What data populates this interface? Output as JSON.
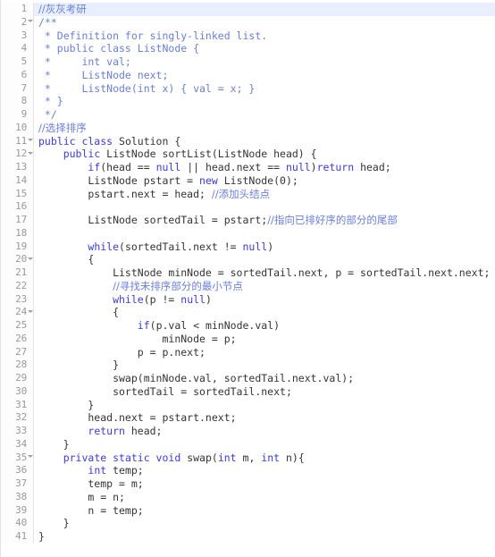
{
  "editor": {
    "language": "java",
    "current_line": 1,
    "total_lines": 41,
    "colors": {
      "background": "#ffffff",
      "gutter_background": "#fdfdfd",
      "gutter_text": "#999999",
      "separator": "#e3e3e3",
      "current_line_highlight": "#e8f0fe",
      "keyword": "#3b3bd6",
      "comment": "#6a7fd4",
      "identifier": "#333333"
    },
    "fold_lines": [
      2,
      11,
      12,
      20,
      24,
      35
    ],
    "lines": [
      {
        "n": "1",
        "tokens": [
          {
            "t": "//灰灰考研",
            "c": "cmt",
            "cjk": true
          }
        ]
      },
      {
        "n": "2",
        "tokens": [
          {
            "t": "/**",
            "c": "cmt"
          }
        ]
      },
      {
        "n": "3",
        "tokens": [
          {
            "t": " * Definition for singly-linked list.",
            "c": "cmt"
          }
        ]
      },
      {
        "n": "4",
        "tokens": [
          {
            "t": " * public class ListNode {",
            "c": "cmt"
          }
        ]
      },
      {
        "n": "5",
        "tokens": [
          {
            "t": " *     int val;",
            "c": "cmt"
          }
        ]
      },
      {
        "n": "6",
        "tokens": [
          {
            "t": " *     ListNode next;",
            "c": "cmt"
          }
        ]
      },
      {
        "n": "7",
        "tokens": [
          {
            "t": " *     ListNode(int x) { val = x; }",
            "c": "cmt"
          }
        ]
      },
      {
        "n": "8",
        "tokens": [
          {
            "t": " * }",
            "c": "cmt"
          }
        ]
      },
      {
        "n": "9",
        "tokens": [
          {
            "t": " */",
            "c": "cmt"
          }
        ]
      },
      {
        "n": "10",
        "tokens": [
          {
            "t": "//选择排序",
            "c": "cmt",
            "cjk": true
          }
        ]
      },
      {
        "n": "11",
        "tokens": [
          {
            "t": "public class",
            "c": "kw"
          },
          {
            "t": " Solution {",
            "c": "id"
          }
        ]
      },
      {
        "n": "12",
        "tokens": [
          {
            "t": "    ",
            "c": "id"
          },
          {
            "t": "public",
            "c": "kw"
          },
          {
            "t": " ListNode sortList(ListNode head) {",
            "c": "id"
          }
        ]
      },
      {
        "n": "13",
        "tokens": [
          {
            "t": "        ",
            "c": "id"
          },
          {
            "t": "if",
            "c": "kw"
          },
          {
            "t": "(head == ",
            "c": "id"
          },
          {
            "t": "null",
            "c": "kw"
          },
          {
            "t": " || head.next == ",
            "c": "id"
          },
          {
            "t": "null",
            "c": "kw"
          },
          {
            "t": ")",
            "c": "id"
          },
          {
            "t": "return",
            "c": "kw"
          },
          {
            "t": " head;",
            "c": "id"
          }
        ]
      },
      {
        "n": "14",
        "tokens": [
          {
            "t": "        ListNode pstart = ",
            "c": "id"
          },
          {
            "t": "new",
            "c": "kw"
          },
          {
            "t": " ListNode(0);",
            "c": "id"
          }
        ]
      },
      {
        "n": "15",
        "tokens": [
          {
            "t": "        pstart.next = head; ",
            "c": "id"
          },
          {
            "t": "//添加头结点",
            "c": "cmt",
            "cjk": true
          }
        ]
      },
      {
        "n": "16",
        "tokens": [
          {
            "t": "",
            "c": "id"
          }
        ]
      },
      {
        "n": "17",
        "tokens": [
          {
            "t": "        ListNode sortedTail = pstart;",
            "c": "id"
          },
          {
            "t": "//指向已排好序的部分的尾部",
            "c": "cmt",
            "cjk": true
          }
        ]
      },
      {
        "n": "18",
        "tokens": [
          {
            "t": "",
            "c": "id"
          }
        ]
      },
      {
        "n": "19",
        "tokens": [
          {
            "t": "        ",
            "c": "id"
          },
          {
            "t": "while",
            "c": "kw"
          },
          {
            "t": "(sortedTail.next != ",
            "c": "id"
          },
          {
            "t": "null",
            "c": "kw"
          },
          {
            "t": ")",
            "c": "id"
          }
        ]
      },
      {
        "n": "20",
        "tokens": [
          {
            "t": "        {",
            "c": "id"
          }
        ]
      },
      {
        "n": "21",
        "tokens": [
          {
            "t": "            ListNode minNode = sortedTail.next, p = sortedTail.next.next;",
            "c": "id"
          }
        ]
      },
      {
        "n": "22",
        "tokens": [
          {
            "t": "            ",
            "c": "id"
          },
          {
            "t": "//寻找未排序部分的最小节点",
            "c": "cmt",
            "cjk": true
          }
        ]
      },
      {
        "n": "23",
        "tokens": [
          {
            "t": "            ",
            "c": "id"
          },
          {
            "t": "while",
            "c": "kw"
          },
          {
            "t": "(p != ",
            "c": "id"
          },
          {
            "t": "null",
            "c": "kw"
          },
          {
            "t": ")",
            "c": "id"
          }
        ]
      },
      {
        "n": "24",
        "tokens": [
          {
            "t": "            {",
            "c": "id"
          }
        ]
      },
      {
        "n": "25",
        "tokens": [
          {
            "t": "                ",
            "c": "id"
          },
          {
            "t": "if",
            "c": "kw"
          },
          {
            "t": "(p.val < minNode.val)",
            "c": "id"
          }
        ]
      },
      {
        "n": "26",
        "tokens": [
          {
            "t": "                    minNode = p;",
            "c": "id"
          }
        ]
      },
      {
        "n": "27",
        "tokens": [
          {
            "t": "                p = p.next;",
            "c": "id"
          }
        ]
      },
      {
        "n": "28",
        "tokens": [
          {
            "t": "            }",
            "c": "id"
          }
        ]
      },
      {
        "n": "29",
        "tokens": [
          {
            "t": "            swap(minNode.val, sortedTail.next.val);",
            "c": "id"
          }
        ]
      },
      {
        "n": "30",
        "tokens": [
          {
            "t": "            sortedTail = sortedTail.next;",
            "c": "id"
          }
        ]
      },
      {
        "n": "31",
        "tokens": [
          {
            "t": "        }",
            "c": "id"
          }
        ]
      },
      {
        "n": "32",
        "tokens": [
          {
            "t": "        head.next = pstart.next;",
            "c": "id"
          }
        ]
      },
      {
        "n": "33",
        "tokens": [
          {
            "t": "        ",
            "c": "id"
          },
          {
            "t": "return",
            "c": "kw"
          },
          {
            "t": " head;",
            "c": "id"
          }
        ]
      },
      {
        "n": "34",
        "tokens": [
          {
            "t": "    }",
            "c": "id"
          }
        ]
      },
      {
        "n": "35",
        "tokens": [
          {
            "t": "    ",
            "c": "id"
          },
          {
            "t": "private static void",
            "c": "kw"
          },
          {
            "t": " swap(",
            "c": "id"
          },
          {
            "t": "int",
            "c": "kw"
          },
          {
            "t": " m, ",
            "c": "id"
          },
          {
            "t": "int",
            "c": "kw"
          },
          {
            "t": " n){",
            "c": "id"
          }
        ]
      },
      {
        "n": "36",
        "tokens": [
          {
            "t": "        ",
            "c": "id"
          },
          {
            "t": "int",
            "c": "kw"
          },
          {
            "t": " temp;",
            "c": "id"
          }
        ]
      },
      {
        "n": "37",
        "tokens": [
          {
            "t": "        temp = m;",
            "c": "id"
          }
        ]
      },
      {
        "n": "38",
        "tokens": [
          {
            "t": "        m = n;",
            "c": "id"
          }
        ]
      },
      {
        "n": "39",
        "tokens": [
          {
            "t": "        n = temp;",
            "c": "id"
          }
        ]
      },
      {
        "n": "40",
        "tokens": [
          {
            "t": "    }",
            "c": "id"
          }
        ]
      },
      {
        "n": "41",
        "tokens": [
          {
            "t": "}",
            "c": "id"
          }
        ]
      }
    ]
  }
}
